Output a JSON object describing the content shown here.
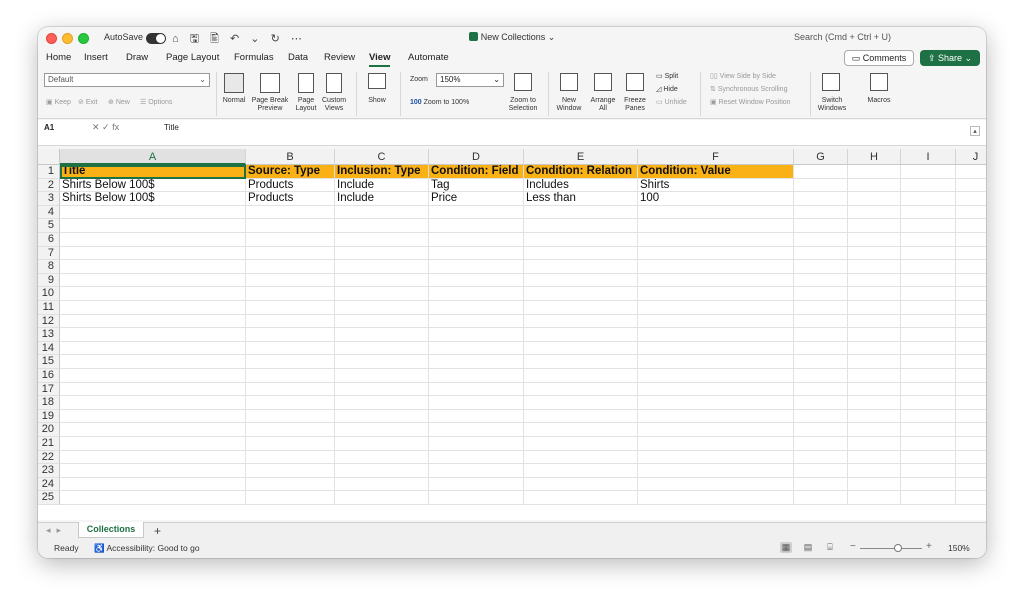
{
  "window": {
    "autosave_label": "AutoSave",
    "toolbar_glyphs": "⌂ 🖫 🖺 ↶ ⌄ ↻ ⋯",
    "title": "New Collections",
    "title_suffix": "⌄",
    "search_label": "Search (Cmd + Ctrl + U)"
  },
  "tabs": [
    "Home",
    "Insert",
    "Draw",
    "Page Layout",
    "Formulas",
    "Data",
    "Review",
    "View",
    "Automate"
  ],
  "active_tab": "View",
  "buttons": {
    "comments": "Comments",
    "share": "Share ⌄"
  },
  "ribbon": {
    "sheet_view_value": "Default",
    "keep": "Keep",
    "exit": "Exit",
    "new": "New",
    "options": "Options",
    "normal": "Normal",
    "page_break_preview": "Page Break Preview",
    "page_layout": "Page Layout",
    "custom_views": "Custom Views",
    "show": "Show",
    "zoom_label": "Zoom",
    "zoom_value": "150%",
    "zoom_to_100": "Zoom to 100%",
    "zoom_to_selection": "Zoom to Selection",
    "new_window": "New Window",
    "arrange_all": "Arrange All",
    "freeze_panes": "Freeze Panes",
    "split": "Split",
    "hide": "Hide",
    "unhide": "Unhide",
    "view_side_by_side": "View Side by Side",
    "synchronous_scrolling": "Synchronous Scrolling",
    "reset_window_position": "Reset Window Position",
    "switch_windows": "Switch Windows",
    "macros": "Macros"
  },
  "formula_bar": {
    "cell_ref": "A1",
    "fx": "✕  ✓  fx",
    "content": "Title"
  },
  "columns": [
    "A",
    "B",
    "C",
    "D",
    "E",
    "F",
    "G",
    "H",
    "I",
    "J"
  ],
  "rows": [
    "1",
    "2",
    "3",
    "4",
    "5",
    "6",
    "7",
    "8",
    "9",
    "10",
    "11",
    "12",
    "13",
    "14",
    "15",
    "16",
    "17",
    "18",
    "19",
    "20",
    "21",
    "22",
    "23",
    "24",
    "25"
  ],
  "cells": [
    [
      "Title",
      "Source: Type",
      "Inclusion: Type",
      "Condition: Field",
      "Condition: Relation",
      "Condition: Value"
    ],
    [
      "Shirts Below 100$",
      "Products",
      "Include",
      "Tag",
      "Includes",
      "Shirts"
    ],
    [
      "Shirts Below 100$",
      "Products",
      "Include",
      "Price",
      "Less than",
      "100"
    ]
  ],
  "sheet_tabs": [
    "Collections"
  ],
  "sheet_add": "+",
  "status": {
    "ready": "Ready",
    "accessibility": "Accessibility: Good to go",
    "zoom": "150%",
    "zoom_level_percent": 150
  },
  "colors": {
    "accent": "#1e7145",
    "header_fill": "#f9b116"
  }
}
